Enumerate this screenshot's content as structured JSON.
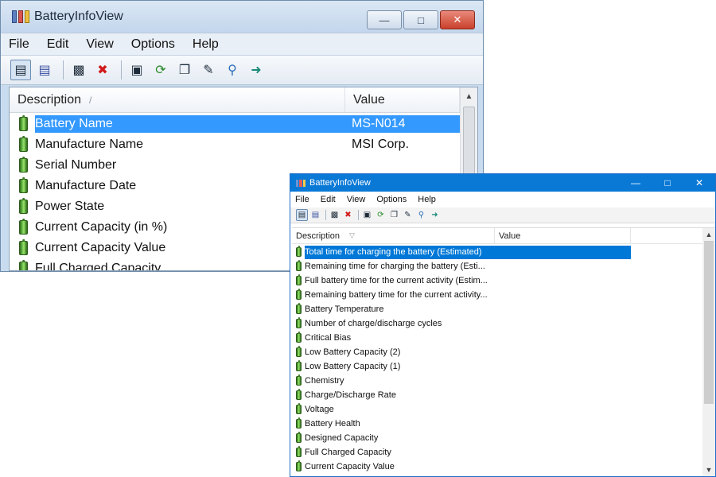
{
  "back_window": {
    "title": "BatteryInfoView",
    "menu": [
      "File",
      "Edit",
      "View",
      "Options",
      "Help"
    ],
    "columns": {
      "description": "Description",
      "value": "Value"
    },
    "rows": [
      {
        "description": "Battery Name",
        "value": "MS-N014",
        "selected": true
      },
      {
        "description": "Manufacture Name",
        "value": "MSI Corp."
      },
      {
        "description": "Serial Number",
        "value": ""
      },
      {
        "description": "Manufacture Date",
        "value": ""
      },
      {
        "description": "Power State",
        "value": ""
      },
      {
        "description": "Current Capacity (in %)",
        "value": ""
      },
      {
        "description": "Current Capacity Value",
        "value": ""
      },
      {
        "description": "Full Charged Capacity",
        "value": ""
      }
    ]
  },
  "front_window": {
    "title": "BatteryInfoView",
    "menu": [
      "File",
      "Edit",
      "View",
      "Options",
      "Help"
    ],
    "columns": {
      "description": "Description",
      "value": "Value"
    },
    "rows": [
      {
        "description": "Total  time for charging the battery (Estimated)",
        "selected": true
      },
      {
        "description": "Remaining time for charging the battery (Esti..."
      },
      {
        "description": "Full battery time for the current activity (Estim..."
      },
      {
        "description": "Remaining battery time for the current activity..."
      },
      {
        "description": "Battery Temperature"
      },
      {
        "description": "Number of charge/discharge cycles"
      },
      {
        "description": "Critical Bias"
      },
      {
        "description": "Low Battery Capacity (2)"
      },
      {
        "description": "Low Battery Capacity (1)"
      },
      {
        "description": "Chemistry"
      },
      {
        "description": "Charge/Discharge Rate"
      },
      {
        "description": "Voltage"
      },
      {
        "description": "Battery Health"
      },
      {
        "description": "Designed Capacity"
      },
      {
        "description": "Full Charged Capacity"
      },
      {
        "description": "Current Capacity Value"
      }
    ]
  },
  "toolbar_icons": [
    "properties-icon",
    "report-icon",
    "html-report-icon",
    "delete-icon",
    "save-icon",
    "refresh-icon",
    "copy-icon",
    "options-icon",
    "find-icon",
    "exit-icon"
  ],
  "colors": {
    "selection_back": "#3399ff",
    "selection_front": "#0078d7",
    "titlebar_front": "#0a79d6"
  }
}
